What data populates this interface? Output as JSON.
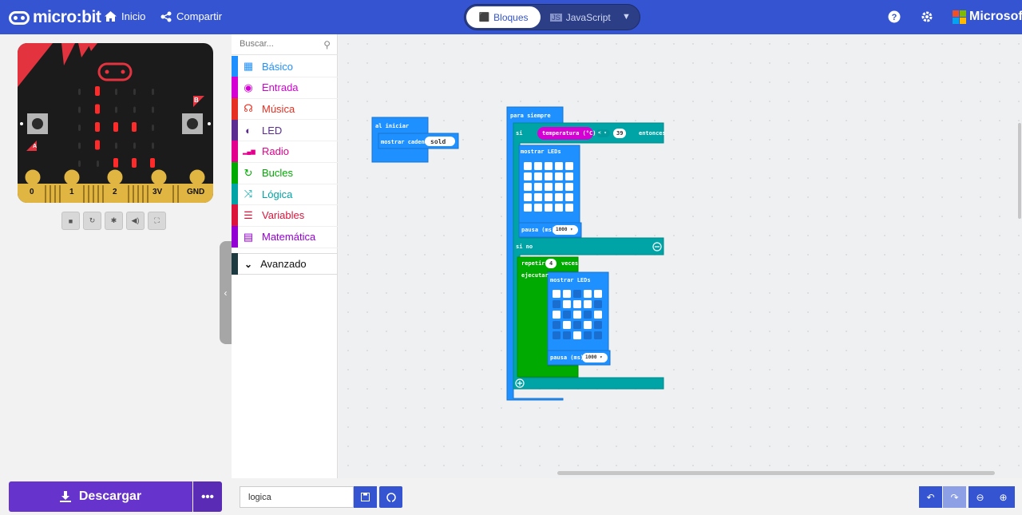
{
  "header": {
    "brand": "micro:bit",
    "home_label": "Inicio",
    "share_label": "Compartir",
    "mode_blocks": "Bloques",
    "mode_js": "JavaScript",
    "ms_label": "Microsoft",
    "colors": {
      "bar": "#3454d1",
      "ms_red": "#f25022",
      "ms_green": "#7fba00",
      "ms_blue": "#00a4ef",
      "ms_yellow": "#ffb900"
    }
  },
  "simulator": {
    "pins": [
      "0",
      "1",
      "2",
      "3V",
      "GND"
    ],
    "button_a": "A",
    "button_b": "B",
    "controls": [
      "stop-icon",
      "restart-icon",
      "debug-icon",
      "mute-icon",
      "fullscreen-icon"
    ]
  },
  "toolbox": {
    "search_placeholder": "Buscar...",
    "categories": [
      {
        "label": "Básico",
        "color": "#1e90ff",
        "icon": "grid-icon"
      },
      {
        "label": "Entrada",
        "color": "#d400d4",
        "icon": "target-icon"
      },
      {
        "label": "Música",
        "color": "#e63022",
        "icon": "headphones-icon"
      },
      {
        "label": "LED",
        "color": "#5c2d91",
        "icon": "toggle-icon"
      },
      {
        "label": "Radio",
        "color": "#e3008c",
        "icon": "signal-icon"
      },
      {
        "label": "Bucles",
        "color": "#00aa00",
        "icon": "loop-icon"
      },
      {
        "label": "Lógica",
        "color": "#00a4a6",
        "icon": "shuffle-icon"
      },
      {
        "label": "Variables",
        "color": "#dc143c",
        "icon": "list-icon"
      },
      {
        "label": "Matemática",
        "color": "#9400d3",
        "icon": "calculator-icon"
      }
    ],
    "advanced_label": "Avanzado"
  },
  "blocks": {
    "on_start": {
      "label": "al iniciar",
      "show_string": "mostrar cadena",
      "string_value": "sold"
    },
    "forever": {
      "label": "para siempre",
      "if_label": "si",
      "temperature": "temperatura (°C)",
      "operator": "< ▾",
      "threshold": "39",
      "then_label": "entonces",
      "show_leds": "mostrar LEDs",
      "pause_label": "pausa (ms)",
      "pause_value": "1000 ▾",
      "else_label": "si no",
      "repeat_label": "repetir",
      "repeat_count": "4",
      "times_label": "veces",
      "do_label": "ejecutar",
      "show_leds_2": "mostrar LEDs",
      "pause_label_2": "pausa (ms)",
      "pause_value_2": "1000 ▾"
    }
  },
  "footer": {
    "download_label": "Descargar",
    "more_label": "•••",
    "project_name": "logica"
  }
}
